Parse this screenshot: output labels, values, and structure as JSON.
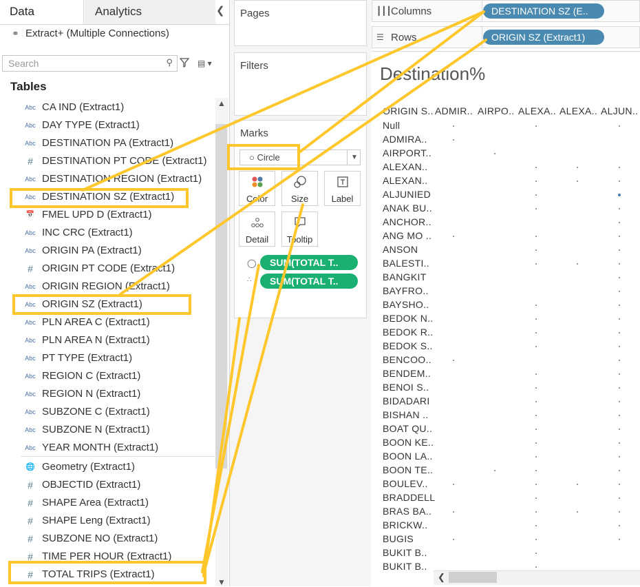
{
  "left_pane": {
    "tabs": [
      "Data",
      "Analytics"
    ],
    "collapse_icon": "chevron-left-icon",
    "connection": "Extract+ (Multiple Connections)",
    "search_placeholder": "Search",
    "tables_heading": "Tables",
    "fields": [
      {
        "type": "Abc",
        "name": "CA IND (Extract1)"
      },
      {
        "type": "Abc",
        "name": "DAY TYPE (Extract1)"
      },
      {
        "type": "Abc",
        "name": "DESTINATION PA (Extract1)"
      },
      {
        "type": "#",
        "name": "DESTINATION PT CODE (Extract1)"
      },
      {
        "type": "Abc",
        "name": "DESTINATION REGION (Extract1)"
      },
      {
        "type": "Abc",
        "name": "DESTINATION SZ (Extract1)"
      },
      {
        "type": "calendar",
        "name": "FMEL UPD D (Extract1)"
      },
      {
        "type": "Abc",
        "name": "INC CRC (Extract1)"
      },
      {
        "type": "Abc",
        "name": "ORIGIN PA (Extract1)"
      },
      {
        "type": "#",
        "name": "ORIGIN PT CODE (Extract1)"
      },
      {
        "type": "Abc",
        "name": "ORIGIN REGION (Extract1)"
      },
      {
        "type": "Abc",
        "name": "ORIGIN SZ (Extract1)"
      },
      {
        "type": "Abc",
        "name": "PLN AREA C (Extract1)"
      },
      {
        "type": "Abc",
        "name": "PLN AREA N (Extract1)"
      },
      {
        "type": "Abc",
        "name": "PT TYPE (Extract1)"
      },
      {
        "type": "Abc",
        "name": "REGION C (Extract1)"
      },
      {
        "type": "Abc",
        "name": "REGION N (Extract1)"
      },
      {
        "type": "Abc",
        "name": "SUBZONE C (Extract1)"
      },
      {
        "type": "Abc",
        "name": "SUBZONE N (Extract1)"
      },
      {
        "type": "Abc",
        "name": "YEAR MONTH (Extract1)"
      }
    ],
    "measures": [
      {
        "type": "globe",
        "name": "Geometry (Extract1)"
      },
      {
        "type": "#",
        "name": "OBJECTID (Extract1)"
      },
      {
        "type": "#",
        "name": "SHAPE Area (Extract1)"
      },
      {
        "type": "#",
        "name": "SHAPE Leng (Extract1)"
      },
      {
        "type": "#",
        "name": "SUBZONE NO (Extract1)"
      },
      {
        "type": "#",
        "name": "TIME PER HOUR (Extract1)"
      },
      {
        "type": "#",
        "name": "TOTAL TRIPS (Extract1)"
      }
    ]
  },
  "shelves": {
    "pages": "Pages",
    "filters": "Filters",
    "marks": "Marks",
    "mark_type": "Circle",
    "mark_buttons": [
      "Color",
      "Size",
      "Label",
      "Detail",
      "Tooltip"
    ],
    "mark_pills": [
      "SUM(TOTAL T..",
      "SUM(TOTAL T.."
    ],
    "columns_label": "Columns",
    "rows_label": "Rows",
    "columns_pill": "DESTINATION SZ (E..",
    "rows_pill": "ORIGIN SZ (Extract1)"
  },
  "viz": {
    "title": "Destination%",
    "row_header": "ORIGIN S..",
    "col_headers": [
      "ADMIR..",
      "AIRPO..",
      "ALEXA..",
      "ALEXA..",
      "ALJUN.."
    ],
    "rows": [
      "Null",
      "ADMIRA..",
      "AIRPORT..",
      "ALEXAN..",
      "ALEXAN..",
      "ALJUNIED",
      "ANAK BU..",
      "ANCHOR..",
      "ANG MO ..",
      "ANSON",
      "BALESTI..",
      "BANGKIT",
      "BAYFRO..",
      "BAYSHO..",
      "BEDOK N..",
      "BEDOK R..",
      "BEDOK S..",
      "BENCOO..",
      "BENDEM..",
      "BENOI S..",
      "BIDADARI",
      "BISHAN ..",
      "BOAT QU..",
      "BOON KE..",
      "BOON LA..",
      "BOON TE..",
      "BOULEV..",
      "BRADDELL",
      "BRAS BA..",
      "BRICKW..",
      "BUGIS",
      "BUKIT B..",
      "BUKIT B.."
    ],
    "marks": [
      [
        1,
        0,
        1,
        0,
        1
      ],
      [
        1,
        0,
        0,
        0,
        0
      ],
      [
        0,
        1,
        0,
        0,
        0
      ],
      [
        0,
        0,
        1,
        1,
        1
      ],
      [
        0,
        0,
        1,
        1,
        1
      ],
      [
        0,
        0,
        1,
        0,
        2
      ],
      [
        0,
        0,
        1,
        0,
        1
      ],
      [
        0,
        0,
        0,
        0,
        1
      ],
      [
        1,
        0,
        1,
        0,
        1
      ],
      [
        0,
        0,
        1,
        0,
        1
      ],
      [
        0,
        0,
        1,
        1,
        1
      ],
      [
        0,
        0,
        0,
        0,
        1
      ],
      [
        0,
        0,
        0,
        0,
        1
      ],
      [
        0,
        0,
        1,
        0,
        1
      ],
      [
        0,
        0,
        1,
        0,
        1
      ],
      [
        0,
        0,
        1,
        0,
        1
      ],
      [
        0,
        0,
        1,
        0,
        1
      ],
      [
        1,
        0,
        0,
        0,
        1
      ],
      [
        0,
        0,
        1,
        0,
        1
      ],
      [
        0,
        0,
        1,
        0,
        1
      ],
      [
        0,
        0,
        1,
        0,
        1
      ],
      [
        0,
        0,
        1,
        0,
        1
      ],
      [
        0,
        0,
        1,
        0,
        1
      ],
      [
        0,
        0,
        1,
        0,
        1
      ],
      [
        0,
        0,
        1,
        0,
        1
      ],
      [
        0,
        1,
        1,
        0,
        1
      ],
      [
        1,
        0,
        1,
        1,
        1
      ],
      [
        0,
        0,
        1,
        0,
        1
      ],
      [
        1,
        0,
        1,
        1,
        1
      ],
      [
        0,
        0,
        1,
        0,
        1
      ],
      [
        1,
        0,
        1,
        0,
        1
      ],
      [
        0,
        0,
        1,
        0,
        0
      ],
      [
        0,
        0,
        1,
        0,
        0
      ]
    ]
  },
  "colors": {
    "highlight": "#ffc72c",
    "pill_green": "#1ab071",
    "pill_blue": "#4a8ab0"
  }
}
